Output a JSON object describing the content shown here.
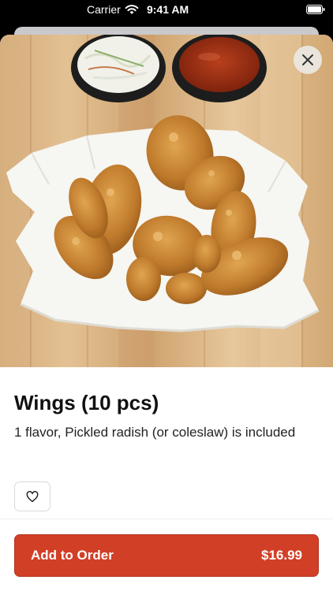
{
  "status_bar": {
    "carrier": "Carrier",
    "time": "9:41 AM"
  },
  "item": {
    "title": "Wings (10 pcs)",
    "description": "1 flavor, Pickled radish (or coleslaw) is included",
    "photo_icon": "fried-chicken-wings-photo"
  },
  "actions": {
    "close_icon": "close-icon",
    "favorite_icon": "heart-outline-icon",
    "add_label": "Add to Order",
    "price": "$16.99"
  },
  "colors": {
    "accent": "#d23f27",
    "text": "#111111"
  }
}
